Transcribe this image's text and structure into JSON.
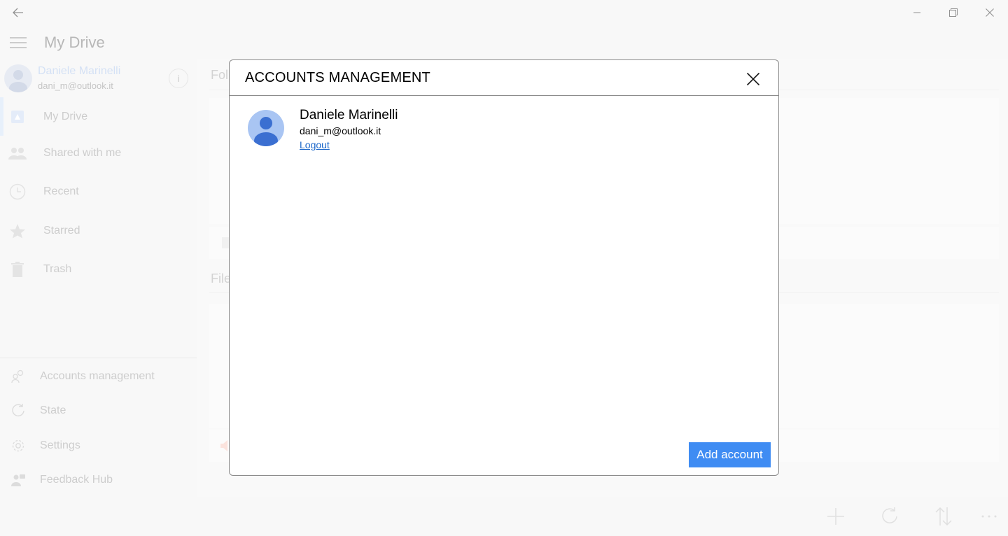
{
  "app": {
    "title": "My Drive"
  },
  "account": {
    "name": "Daniele Marinelli",
    "email": "dani_m@outlook.it",
    "info_label": "i"
  },
  "nav": {
    "items": [
      {
        "label": "My Drive",
        "icon": "drive-icon"
      },
      {
        "label": "Shared with me",
        "icon": "people-icon"
      },
      {
        "label": "Recent",
        "icon": "clock-icon"
      },
      {
        "label": "Starred",
        "icon": "star-icon"
      },
      {
        "label": "Trash",
        "icon": "trash-icon"
      }
    ],
    "bottom": [
      {
        "label": "Accounts management",
        "icon": "accounts-icon"
      },
      {
        "label": "State",
        "icon": "refresh-icon"
      },
      {
        "label": "Settings",
        "icon": "gear-icon"
      },
      {
        "label": "Feedback Hub",
        "icon": "feedback-icon"
      }
    ]
  },
  "main": {
    "folders_heading": "Fol",
    "files_heading": "File"
  },
  "dialog": {
    "title": "ACCOUNTS MANAGEMENT",
    "account_name": "Daniele Marinelli",
    "account_email": "dani_m@outlook.it",
    "logout_label": "Logout",
    "add_button": "Add account"
  },
  "colors": {
    "accent": "#3f8cf3",
    "link": "#1a66c9",
    "avatar": "#a9c5f3",
    "avatar_figure": "#3b6fd1"
  }
}
